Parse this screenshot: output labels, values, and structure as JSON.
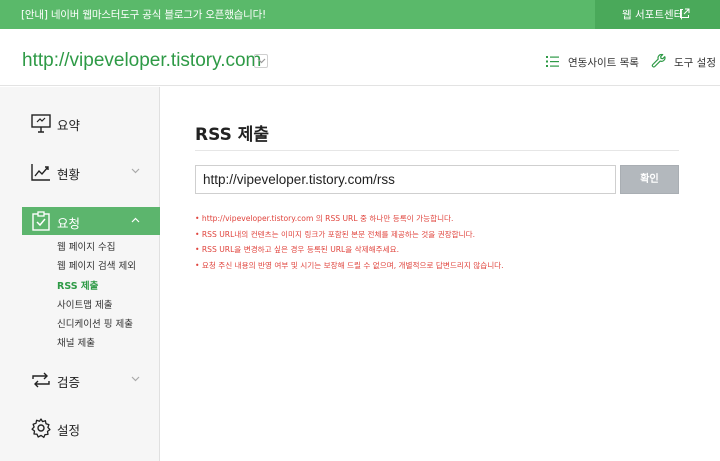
{
  "notice": {
    "text": "[안내] 네이버 웹마스터도구 공식 블로그가 오픈했습니다!",
    "support_label": "웹 서포트센터"
  },
  "header": {
    "site_url": "http://vipeveloper.tistory.com",
    "linked_sites": "연동사이트 목록",
    "tool_settings": "도구 설정"
  },
  "sidebar": {
    "items": [
      {
        "label": "요약",
        "icon": "summary-board-icon"
      },
      {
        "label": "현황",
        "icon": "trend-chart-icon"
      },
      {
        "label": "요청",
        "icon": "clipboard-check-icon"
      },
      {
        "label": "검증",
        "icon": "sync-arrows-icon"
      },
      {
        "label": "설정",
        "icon": "gear-icon"
      }
    ],
    "submenu": [
      "웹 페이지 수집",
      "웹 페이지 검색 제외",
      "RSS 제출",
      "사이트맵 제출",
      "신디케이션 핑 제출",
      "채널 제출"
    ]
  },
  "main": {
    "title": "RSS 제출",
    "input_value": "http://vipeveloper.tistory.com/rss",
    "confirm_label": "확인",
    "notes": [
      "http://vipeveloper.tistory.com 의 RSS URL 중 하나만 등록이 가능합니다.",
      "RSS URL내의 컨텐츠는 이미지 링크가 포함된 본문 전체를 제공하는 것을 권장합니다.",
      "RSS URL을 변경하고 싶은 경우 등록된 URL을 삭제해주세요.",
      "요청 주신 내용의 반영 여부 및 시기는 보장해 드릴 수 없으며, 개별적으로 답변드리지 않습니다."
    ]
  },
  "colors": {
    "brand_green": "#5ab96a",
    "link_green": "#2e9a46",
    "note_red": "#e0443d"
  }
}
